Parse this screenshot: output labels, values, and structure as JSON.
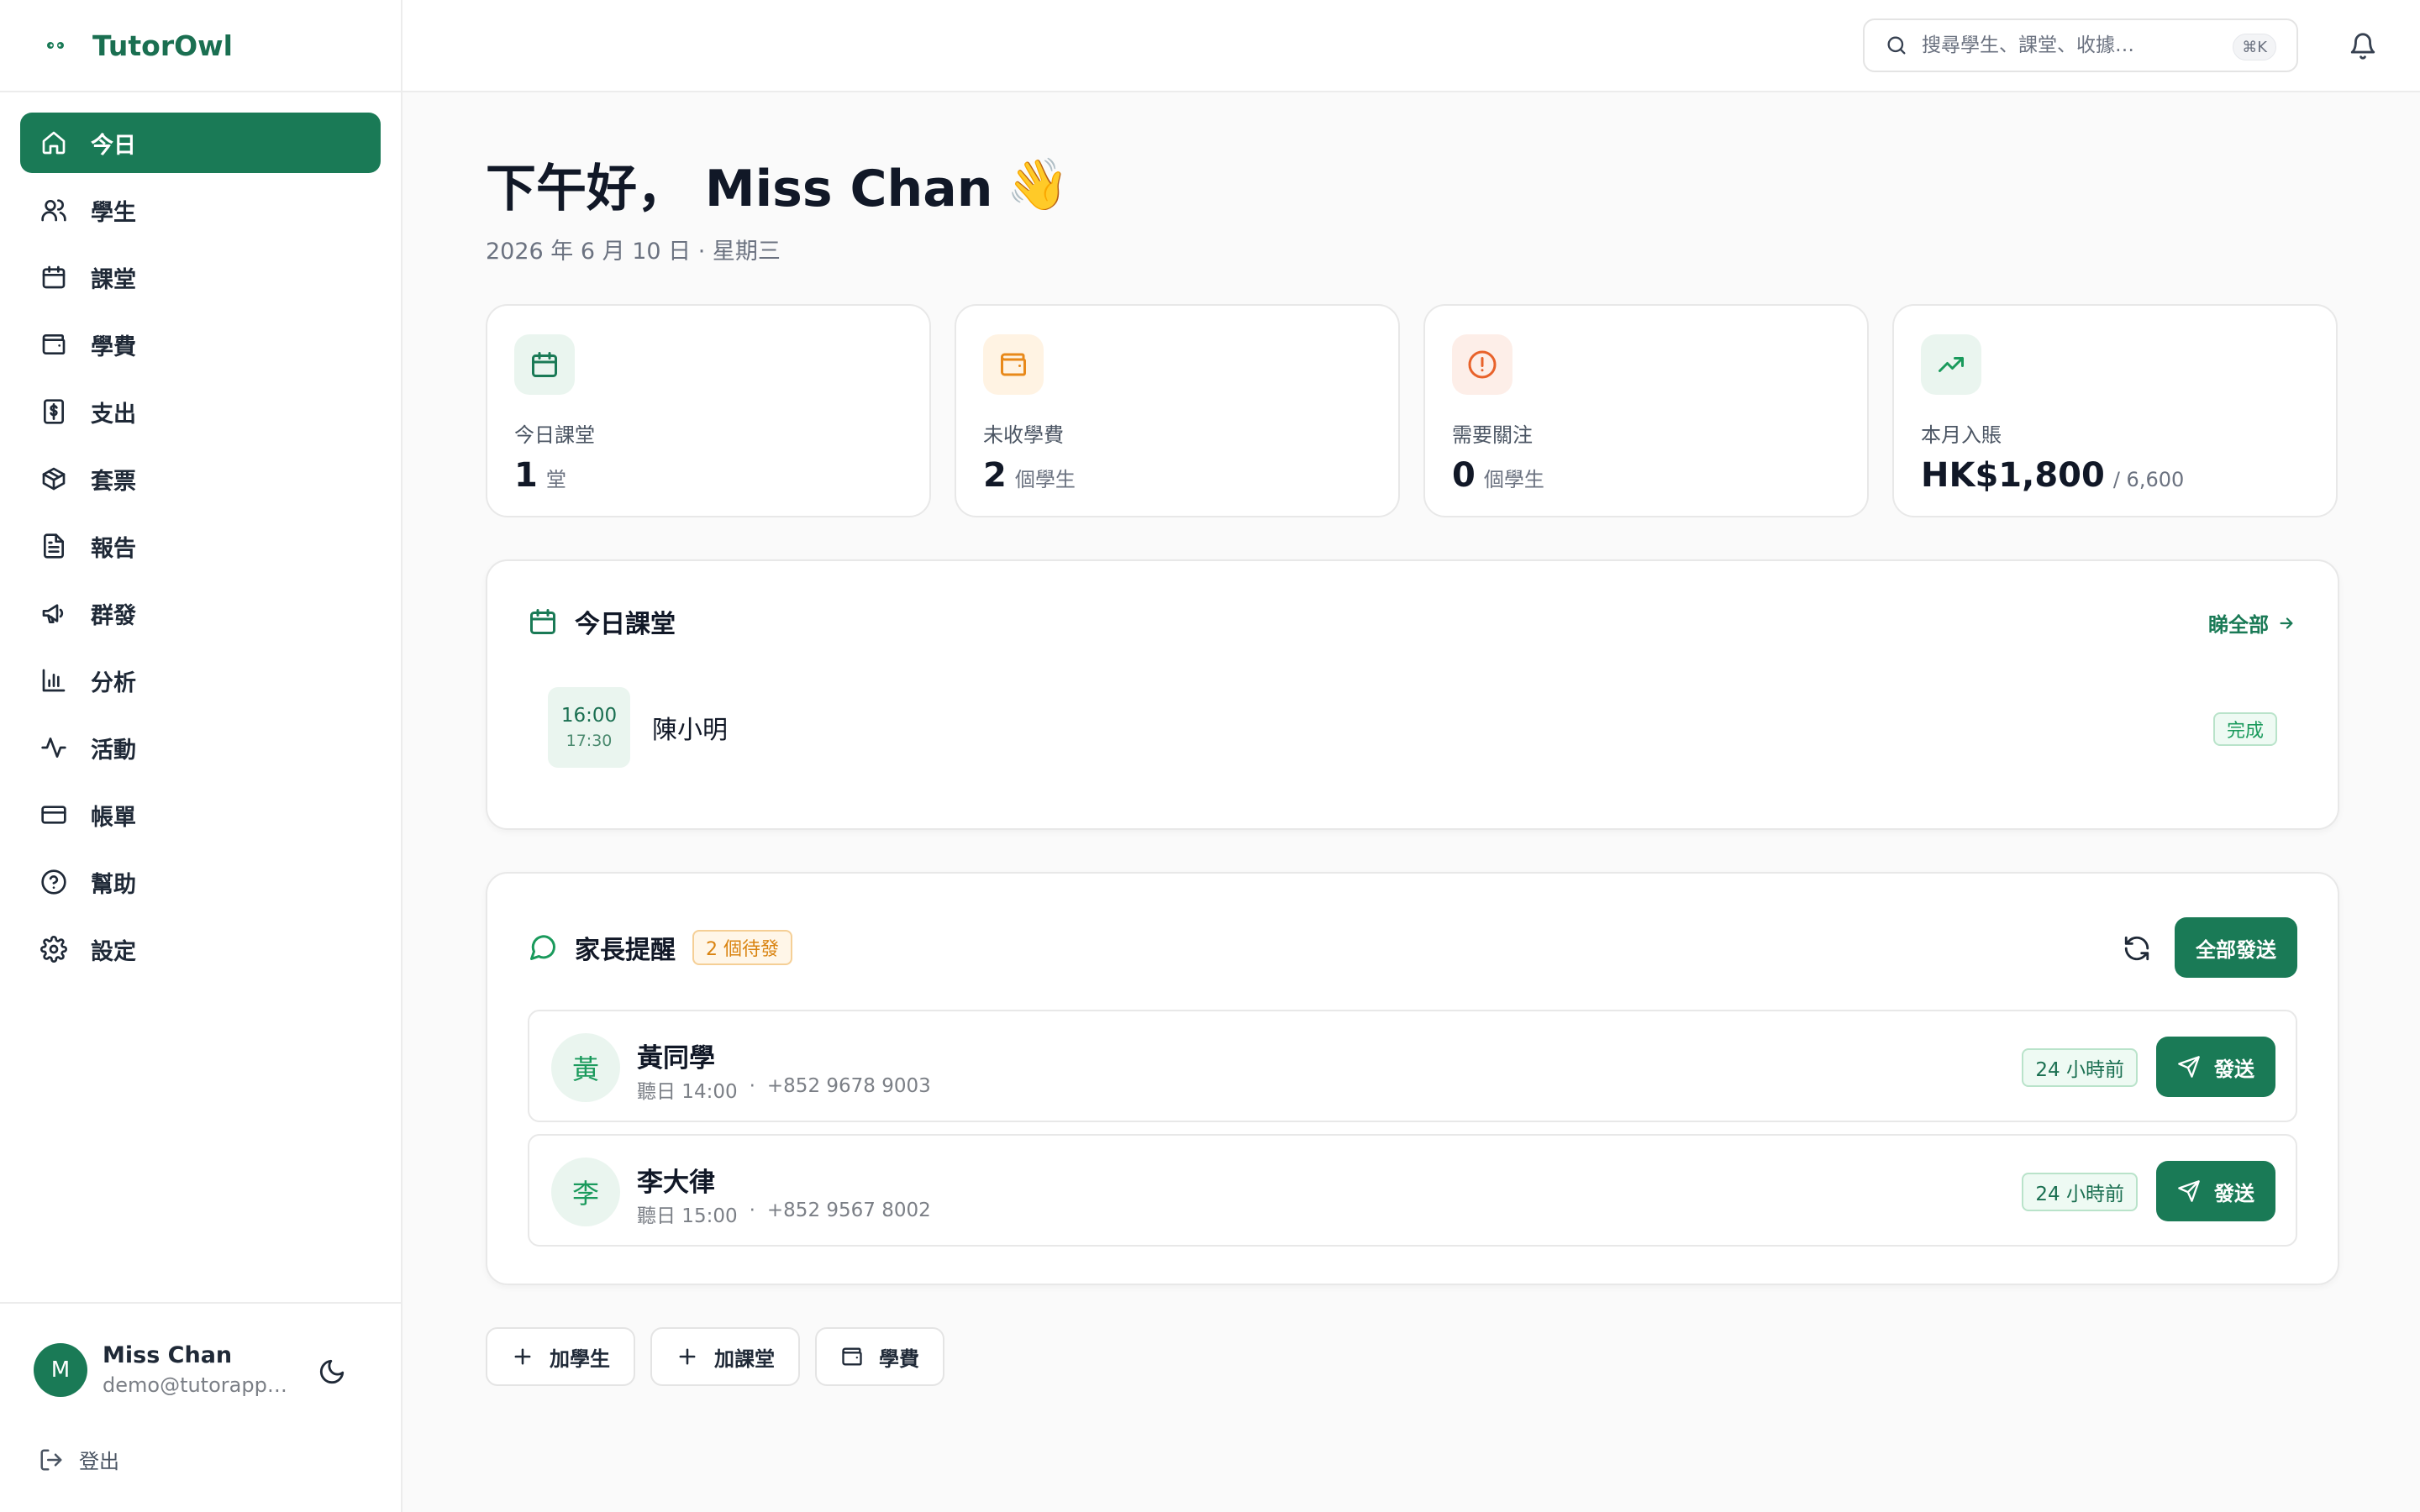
{
  "app": {
    "name": "TutorOwl",
    "accent": "#1a7a56"
  },
  "sidebar": {
    "items": [
      {
        "label": "今日",
        "icon": "home-icon",
        "active": true
      },
      {
        "label": "學生",
        "icon": "users-icon"
      },
      {
        "label": "課堂",
        "icon": "calendar-icon"
      },
      {
        "label": "學費",
        "icon": "wallet-icon"
      },
      {
        "label": "支出",
        "icon": "receipt-icon"
      },
      {
        "label": "套票",
        "icon": "package-icon"
      },
      {
        "label": "報告",
        "icon": "file-icon"
      },
      {
        "label": "群發",
        "icon": "megaphone-icon"
      },
      {
        "label": "分析",
        "icon": "bar-chart-icon"
      },
      {
        "label": "活動",
        "icon": "activity-icon"
      },
      {
        "label": "帳單",
        "icon": "credit-card-icon"
      },
      {
        "label": "幫助",
        "icon": "help-circle-icon"
      },
      {
        "label": "設定",
        "icon": "gear-icon"
      }
    ],
    "user": {
      "initial": "M",
      "name": "Miss Chan",
      "email": "demo@tutorapp.com"
    },
    "logout_label": "登出"
  },
  "topbar": {
    "search_placeholder": "搜尋學生、課堂、收據…",
    "shortcut": "⌘K"
  },
  "greeting": {
    "text": "下午好， Miss Chan",
    "emoji": "👋",
    "date": "2026 年 6 月 10 日 · 星期三"
  },
  "stats": [
    {
      "label": "今日課堂",
      "value": "1",
      "unit": "堂",
      "icon": "calendar-icon",
      "color": "#1a7a56",
      "bg": "#eaf5ef"
    },
    {
      "label": "未收學費",
      "value": "2",
      "unit": "個學生",
      "icon": "wallet-icon",
      "color": "#e8891a",
      "bg": "#fff3e3"
    },
    {
      "label": "需要關注",
      "value": "0",
      "unit": "個學生",
      "icon": "alert-circle-icon",
      "color": "#e8622a",
      "bg": "#fdeee8"
    },
    {
      "label": "本月入賬",
      "value": "HK$1,800",
      "unit": "/ 6,600",
      "icon": "trending-up-icon",
      "color": "#1a9a5c",
      "bg": "#eaf5ef"
    }
  ],
  "today": {
    "title": "今日課堂",
    "see_all": "睇全部",
    "lessons": [
      {
        "start": "16:00",
        "end": "17:30",
        "student": "陳小明",
        "status": "完成"
      }
    ]
  },
  "reminders": {
    "title": "家長提醒",
    "pending": "2 個待發",
    "send_all": "全部發送",
    "items": [
      {
        "initial": "黃",
        "name": "黃同學",
        "when": "聽日 14:00",
        "phone": "+852 9678 9003",
        "ago": "24 小時前",
        "send": "發送"
      },
      {
        "initial": "李",
        "name": "李大律",
        "when": "聽日 15:00",
        "phone": "+852 9567 8002",
        "ago": "24 小時前",
        "send": "發送"
      }
    ]
  },
  "quick_actions": [
    {
      "label": "加學生",
      "icon": "plus-icon"
    },
    {
      "label": "加課堂",
      "icon": "plus-icon"
    },
    {
      "label": "學費",
      "icon": "wallet-icon"
    }
  ]
}
